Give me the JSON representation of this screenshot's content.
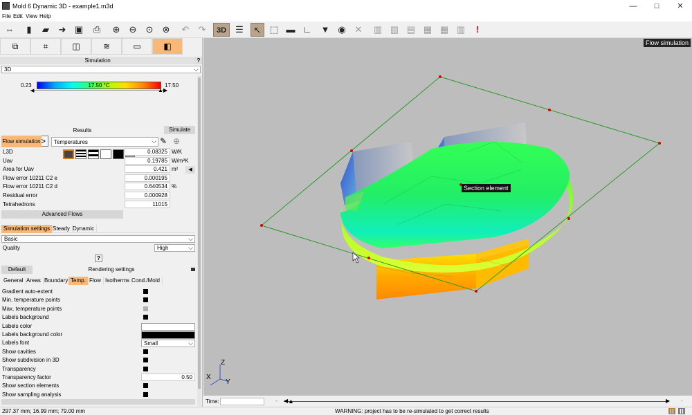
{
  "window": {
    "title": "Mold 6 Dynamic 3D - example1.m3d"
  },
  "menu": [
    "File",
    "Edit",
    "View",
    "Help"
  ],
  "toolbar": {
    "mode_3d_label": "3D",
    "flow_simulation_badge": "Flow simulation"
  },
  "left_panel": {
    "simulation_header": "Simulation",
    "help_label": "?",
    "view_mode": "3D",
    "legend": {
      "min": "0.23",
      "center": "17.50 °C",
      "max": "17.50"
    },
    "nav": {
      "prev": "<",
      "eq": "=",
      "next": ">"
    },
    "field_select": "Temperatures",
    "results_tab": "Results",
    "simulate_tab": "Simulate",
    "flow_sim_tab": "Flow simulation",
    "results": [
      {
        "label": "L3D",
        "value": "0.08325",
        "unit": "W/K"
      },
      {
        "label": "Uav",
        "value": "0.19785",
        "unit": "W/m²K"
      },
      {
        "label": "Area for Uav",
        "value": "0.421",
        "unit": "m²"
      },
      {
        "label": "Flow error 10211 C2 e",
        "value": "0.000195",
        "unit": ""
      },
      {
        "label": "Flow error 10211 C2 d",
        "value": "0.640534",
        "unit": "%"
      },
      {
        "label": "Residual error",
        "value": "0.000928",
        "unit": ""
      },
      {
        "label": "Tetrahedrons",
        "value": "11015",
        "unit": ""
      }
    ],
    "advanced_flows": "Advanced Flows",
    "sim_tabs": [
      "Simulation settings",
      "Steady",
      "Dynamic"
    ],
    "sim_mode": "Basic",
    "quality_label": "Quality",
    "quality_value": "High",
    "question": "?",
    "default_btn": "Default",
    "rendering_header": "Rendering settings",
    "render_tabs": [
      "General",
      "Areas",
      "Boundary",
      "Temp.",
      "Flow",
      "Isotherms",
      "Cond./Mold"
    ],
    "settings": [
      {
        "label": "Gradient auto-extent",
        "type": "check",
        "on": true
      },
      {
        "label": "Min. temperature points",
        "type": "check",
        "on": true
      },
      {
        "label": "Max. temperature points",
        "type": "check",
        "on": false
      },
      {
        "label": "Labels background",
        "type": "check",
        "on": true
      },
      {
        "label": "Labels color",
        "type": "color",
        "color": "#ffffff"
      },
      {
        "label": "Labels background color",
        "type": "color",
        "color": "#000000"
      },
      {
        "label": "Labels font",
        "type": "select",
        "value": "Small"
      },
      {
        "label": "Show cavities",
        "type": "check",
        "on": true
      },
      {
        "label": "Show subdivision in 3D",
        "type": "check",
        "on": true
      },
      {
        "label": "Transparency",
        "type": "check",
        "on": true
      },
      {
        "label": "Transparency factor",
        "type": "value",
        "value": "0.50"
      },
      {
        "label": "Show section elements",
        "type": "check",
        "on": true
      },
      {
        "label": "Show sampling analysis",
        "type": "check",
        "on": true
      }
    ]
  },
  "viewport": {
    "section_label": "Section element",
    "axes": {
      "z": "Z",
      "x": "X",
      "y": "Y"
    }
  },
  "timebar": {
    "label": "Time:",
    "value": ""
  },
  "status": {
    "coords": "297.37 mm; 16.99 mm; 79.00 mm",
    "warning": "WARNING: project has to be re-simulated to get correct results"
  }
}
